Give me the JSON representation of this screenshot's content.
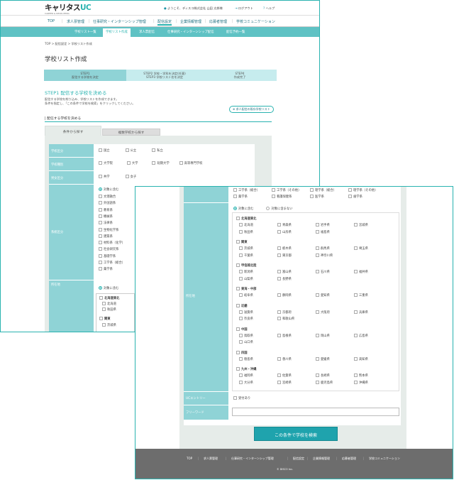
{
  "header": {
    "logo": "キャリタス",
    "logo_accent": "UC",
    "logo_sub": "CAREER & RECRUITING",
    "welcome": "ようこそ、ディスコ株式会社 山田 太郎様",
    "logout": "ログアウト",
    "help": "ヘルプ"
  },
  "menu": [
    "TOP",
    "求人票管理",
    "仕事研究・インターンシップ管理",
    "配信設定",
    "企業情報管理",
    "応募者管理",
    "学校コミュニケーション"
  ],
  "submenu": [
    "学校リスト一覧",
    "学校リスト作成",
    "求人票配信",
    "仕事研究・インターンシップ配信",
    "配信予約一覧"
  ],
  "breadcrumb": "TOP > 配信設定 > 学校リスト作成",
  "page_title": "学校リスト作成",
  "steps": [
    [
      "STEP1",
      "配信する学校を決定"
    ],
    [
      "STEP2 学校・学科を決定(任意)",
      "STEP3 学校リスト名を決定"
    ],
    [
      "STEP4",
      "作成完了"
    ]
  ],
  "step_heading": "STEP1 配信する学校を決める",
  "desc1": "配信する学校を絞り込み、学校リストを作成できます。",
  "desc2": "条件を指定し、「この条件で学校を検索」をクリックしてください。",
  "add_button": "求人配信の既存学校リスト",
  "section_label": "配信する学校を決める",
  "tabs": [
    "条件から探す",
    "複数学校から探す"
  ],
  "labels": {
    "kind": "学校区分",
    "type": "学校種別",
    "gender": "男女区分",
    "faculty": "系統区分",
    "location": "所在地",
    "uc_entry": "UCエントリー",
    "free_word": "フリーワード"
  },
  "kind_opts": [
    "国立",
    "公立",
    "私立"
  ],
  "type_opts": [
    "大学院",
    "大学",
    "短期大学",
    "高等専門学校"
  ],
  "gender_opts": [
    "共学",
    "女子"
  ],
  "target_all": "対象に含む",
  "target_none": "対象に含まない",
  "faculty_opts": [
    "文理融合",
    "外国語系",
    "教育系",
    "社会系",
    "家政系",
    "理工系",
    "生物学系",
    "農学系",
    "資源系",
    "薬学系",
    "医療系",
    "医系",
    "医療系（医学部系）",
    "医学系（看護）",
    "歯学系"
  ],
  "faculty_opts_w1": [
    "文理融合",
    "外国語系",
    "教育系",
    "機械系",
    "法律系",
    "生物化学系",
    "建築系",
    "材料系（化学）",
    "社会研究系",
    "基礎学系",
    "工学系（総合）",
    "薬学系"
  ],
  "w2_top": [
    "工学系（総合）",
    "工学系（その他）",
    "理学系（総合）",
    "理学系（その他）",
    "薬学系",
    "看護保健系",
    "医学系",
    "歯学系"
  ],
  "regions": [
    {
      "name": "北海道東北",
      "prefs": [
        "北海道",
        "青森県",
        "岩手県",
        "宮城県",
        "秋田県",
        "山形県",
        "福島県"
      ]
    },
    {
      "name": "関東",
      "prefs": [
        "茨城県",
        "栃木県",
        "群馬県",
        "埼玉県",
        "千葉県",
        "東京都",
        "神奈川県"
      ]
    },
    {
      "name": "甲信越北陸",
      "prefs": [
        "新潟県",
        "富山県",
        "石川県",
        "福井県",
        "山梨県",
        "長野県"
      ]
    },
    {
      "name": "東海・中部",
      "prefs": [
        "岐阜県",
        "静岡県",
        "愛知県",
        "三重県"
      ]
    },
    {
      "name": "近畿",
      "prefs": [
        "滋賀県",
        "京都府",
        "大阪府",
        "兵庫県",
        "奈良県",
        "和歌山県"
      ]
    },
    {
      "name": "中国",
      "prefs": [
        "鳥取県",
        "島根県",
        "岡山県",
        "広島県",
        "山口県"
      ]
    },
    {
      "name": "四国",
      "prefs": [
        "徳島県",
        "香川県",
        "愛媛県",
        "高知県"
      ]
    },
    {
      "name": "九州・沖縄",
      "prefs": [
        "福岡県",
        "佐賀県",
        "長崎県",
        "熊本県",
        "大分県",
        "宮崎県",
        "鹿児島県",
        "沖縄県"
      ]
    }
  ],
  "uc_entry_opt": "受付あり",
  "search_button": "この条件で学校を検索",
  "footer": [
    "TOP",
    "求人票管理",
    "仕事研究・インターンシップ管理",
    "配信設定",
    "企業情報管理",
    "応募者管理",
    "学校コミュニケーション"
  ],
  "copyright": "© DISCO Inc."
}
